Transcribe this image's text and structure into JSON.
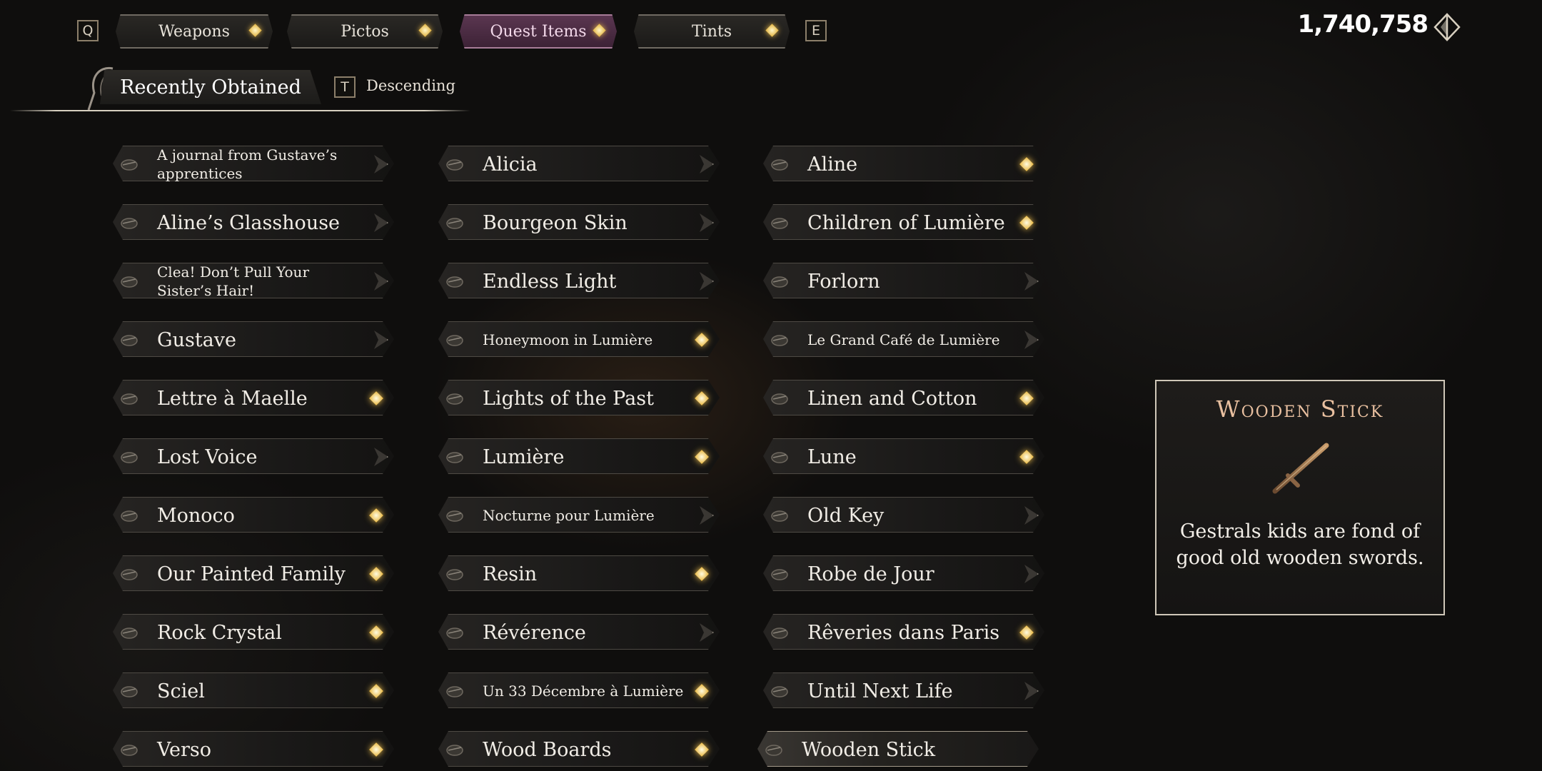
{
  "header": {
    "left_key": "Q",
    "right_key": "E",
    "tabs": [
      {
        "label": "Weapons"
      },
      {
        "label": "Pictos"
      },
      {
        "label": "Quest Items"
      },
      {
        "label": "Tints"
      }
    ],
    "currency": "1,740,758"
  },
  "sort": {
    "label": "Recently Obtained",
    "key": "T",
    "order": "Descending"
  },
  "items": [
    {
      "label": "A journal from Gustave’s apprentices",
      "new": false
    },
    {
      "label": "Alicia",
      "new": false
    },
    {
      "label": "Aline",
      "new": true
    },
    {
      "label": "Aline’s Glasshouse",
      "new": false
    },
    {
      "label": "Bourgeon Skin",
      "new": false
    },
    {
      "label": "Children of Lumière",
      "new": true
    },
    {
      "label": "Clea! Don’t Pull Your Sister’s Hair!",
      "new": false
    },
    {
      "label": "Endless Light",
      "new": false
    },
    {
      "label": "Forlorn",
      "new": false
    },
    {
      "label": "Gustave",
      "new": false
    },
    {
      "label": "Honeymoon in Lumière",
      "new": true
    },
    {
      "label": "Le Grand Café de Lumière",
      "new": false
    },
    {
      "label": "Lettre à Maelle",
      "new": true
    },
    {
      "label": "Lights of the Past",
      "new": true
    },
    {
      "label": "Linen and Cotton",
      "new": true
    },
    {
      "label": "Lost Voice",
      "new": false
    },
    {
      "label": "Lumière",
      "new": true
    },
    {
      "label": "Lune",
      "new": true
    },
    {
      "label": "Monoco",
      "new": true
    },
    {
      "label": "Nocturne pour Lumière",
      "new": false
    },
    {
      "label": "Old Key",
      "new": false
    },
    {
      "label": "Our Painted Family",
      "new": true
    },
    {
      "label": "Resin",
      "new": true
    },
    {
      "label": "Robe de Jour",
      "new": false
    },
    {
      "label": "Rock Crystal",
      "new": true
    },
    {
      "label": "Révérence",
      "new": false
    },
    {
      "label": "Rêveries dans Paris",
      "new": true
    },
    {
      "label": "Sciel",
      "new": true
    },
    {
      "label": "Un 33 Décembre à Lumière",
      "new": true
    },
    {
      "label": "Until Next Life",
      "new": false
    },
    {
      "label": "Verso",
      "new": true
    },
    {
      "label": "Wood Boards",
      "new": true
    },
    {
      "label": "Wooden Stick",
      "new": false
    }
  ],
  "selected_item": "Wooden Stick",
  "detail": {
    "title": "Wooden Stick",
    "description": "Gestrals kids are fond of good old wooden swords."
  },
  "colors": {
    "accent_gold": "#e6b84a",
    "active_tab": "#5a3650",
    "detail_title": "#e9c0a0"
  }
}
